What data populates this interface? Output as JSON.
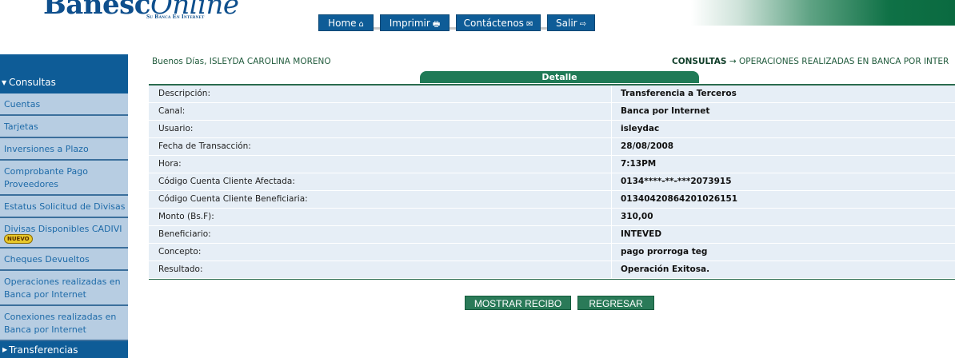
{
  "header": {
    "logo_main": "Banesc",
    "logo_online": "Online",
    "tagline": "Su Banca En Internet",
    "nav": [
      {
        "label": "Home",
        "icon": "⌂"
      },
      {
        "label": "Imprimir",
        "icon": "🖶"
      },
      {
        "label": "Contáctenos",
        "icon": "✉"
      },
      {
        "label": "Salir",
        "icon": "⇨"
      }
    ]
  },
  "sidebar": {
    "section": "Consultas",
    "items": [
      {
        "label": "Cuentas"
      },
      {
        "label": "Tarjetas"
      },
      {
        "label": "Inversiones a Plazo"
      },
      {
        "label": "Comprobante Pago Proveedores"
      },
      {
        "label": "Estatus Solicitud de Divisas"
      },
      {
        "label": "Divisas Disponibles CADIVI",
        "badge": "NUEVO"
      },
      {
        "label": "Cheques Devueltos"
      },
      {
        "label": "Operaciones realizadas en Banca por Internet"
      },
      {
        "label": "Conexiones realizadas en Banca por Internet"
      }
    ],
    "footer": "Transferencias"
  },
  "main": {
    "greeting": "Buenos Días, ISLEYDA CAROLINA MORENO",
    "breadcrumb_section": "CONSULTAS",
    "breadcrumb_arrow": "→",
    "breadcrumb_page": "OPERACIONES REALIZADAS EN BANCA POR INTER",
    "tab_title": "Detalle",
    "rows": [
      {
        "label": "Descripción:",
        "value": "Transferencia a Terceros"
      },
      {
        "label": "Canal:",
        "value": "Banca por Internet"
      },
      {
        "label": "Usuario:",
        "value": "isleydac"
      },
      {
        "label": "Fecha de Transacción:",
        "value": "28/08/2008"
      },
      {
        "label": "Hora:",
        "value": "7:13PM"
      },
      {
        "label": "Código Cuenta Cliente Afectada:",
        "value": "0134****-**-***2073915"
      },
      {
        "label": "Código Cuenta Cliente Beneficiaria:",
        "value": "01340420864201026151"
      },
      {
        "label": "Monto (Bs.F):",
        "value": "310,00"
      },
      {
        "label": "Beneficiario:",
        "value": "INTEVED"
      },
      {
        "label": "Concepto:",
        "value": "pago prorroga teg"
      },
      {
        "label": "Resultado:",
        "value": "Operación Exitosa."
      }
    ],
    "buttons": {
      "show_receipt": "MOSTRAR RECIBO",
      "back": "REGRESAR"
    }
  }
}
